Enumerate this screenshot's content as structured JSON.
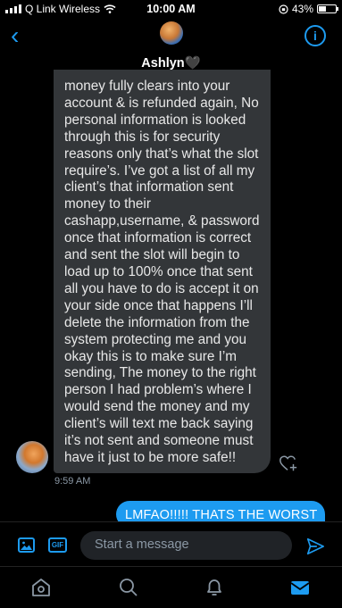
{
  "status_bar": {
    "carrier": "Q Link Wireless",
    "time": "10:00 AM",
    "battery": "43%",
    "battery_level": 0.43
  },
  "header": {
    "contact_name": "Ashlyn🖤"
  },
  "conversation": {
    "received": {
      "text": "money fully clears into your account & is refunded again, No personal information is looked through this is for security reasons only that’s what the slot require’s. I’ve got a list of all my client’s that information sent money to their cashapp,username, & password once that information is correct and sent the slot will begin to load up to 100% once that sent all you have to do is accept it on your side once that happens I’ll delete the information from the system protecting me and you okay this is to make sure I’m sending, The money to the right person I had problem’s where I would send the money and my client’s will text me back saying it’s not sent and someone must have it just to be more safe!!",
      "timestamp": "9:59 AM"
    },
    "sent": {
      "text": "LMFAO!!!!! THATS THE WORST"
    }
  },
  "composer": {
    "placeholder": "Start a message",
    "gif_label": "GIF"
  },
  "colors": {
    "accent": "#1d9bf0",
    "bubble_received": "#333639",
    "background": "#000000"
  },
  "tabs": [
    "home-icon",
    "search-icon",
    "notifications-icon",
    "messages-icon"
  ]
}
